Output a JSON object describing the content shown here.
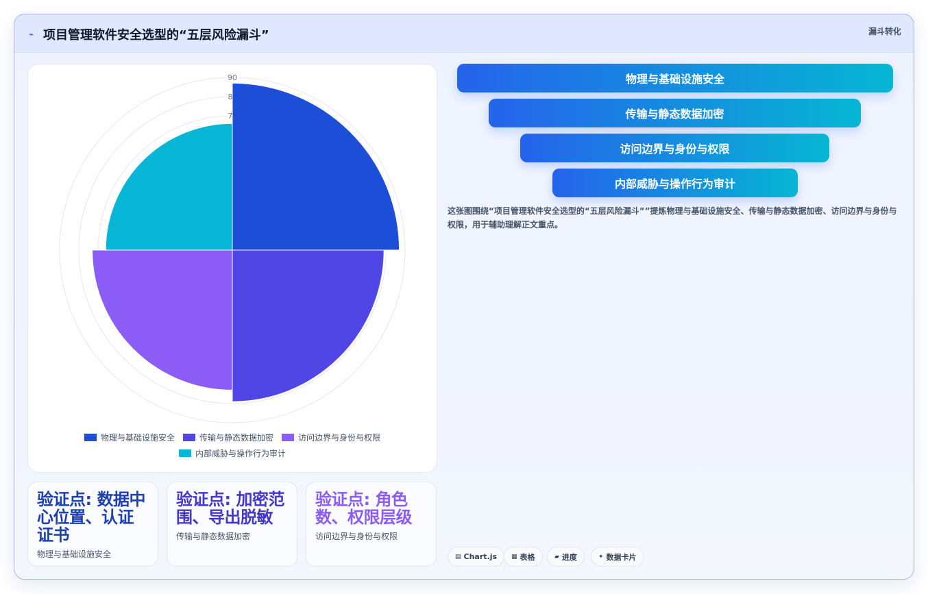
{
  "header": {
    "icon": "line-chart-icon",
    "title": "项目管理软件安全选型的“五层风险漏斗”",
    "tag": "漏斗转化"
  },
  "chart_data": {
    "type": "polarArea",
    "labels": [
      "物理与基础设施安全",
      "传输与静态数据加密",
      "访问边界与身份与权限",
      "内部威胁与操作行为审计"
    ],
    "values": [
      87,
      79,
      73,
      66
    ],
    "colors": [
      "#1d4ed8",
      "#4f46e5",
      "#8b5cf6",
      "#06b6d4"
    ],
    "r_ticks": [
      "90",
      "8",
      "7"
    ],
    "r_max": 90,
    "legend_position": "bottom"
  },
  "stats": [
    {
      "value": "验证点: 数据中心位置、认证证书",
      "label": "物理与基础设施安全",
      "color": "#1e40af"
    },
    {
      "value": "验证点: 加密范围、导出脱敏",
      "label": "传输与静态数据加密",
      "color": "#4338ca"
    },
    {
      "value": "验证点: 角色数、权限层级",
      "label": "访问边界与身份与权限",
      "color": "#8b5cf6"
    }
  ],
  "funnel": [
    "物理与基础设施安全",
    "传输与静态数据加密",
    "访问边界与身份与权限",
    "内部威胁与操作行为审计"
  ],
  "description": "这张图围绕“项目管理软件安全选型的“五层风险漏斗””提炼物理与基础设施安全、传输与静态数据加密、访问边界与身份与权限，用于辅助理解正文重点。",
  "chips": [
    {
      "icon": "chart-icon",
      "glyph": "▤",
      "label": "Chart.js"
    },
    {
      "icon": "table-icon",
      "glyph": "▦",
      "label": "表格"
    },
    {
      "icon": "progress-icon",
      "glyph": "▰",
      "label": "进度"
    },
    {
      "icon": "sparkle-icon",
      "glyph": "✦",
      "label": "数据卡片"
    }
  ]
}
